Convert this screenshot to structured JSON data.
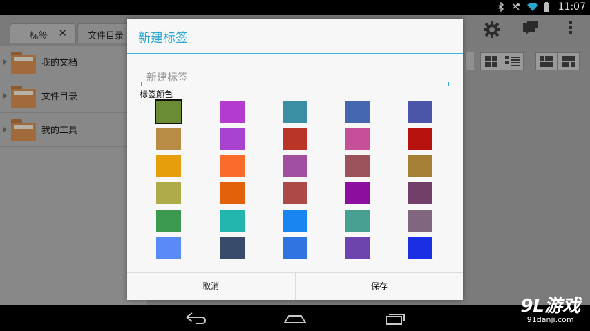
{
  "status_bar": {
    "time": "11:07",
    "icons": [
      "bluetooth-icon",
      "silent-icon",
      "wifi-icon",
      "battery-icon"
    ]
  },
  "tabs": [
    {
      "label": "标签",
      "closable": true
    },
    {
      "label": "文件目录"
    }
  ],
  "sidebar": {
    "items": [
      {
        "label": "我的文档"
      },
      {
        "label": "文件目录"
      },
      {
        "label": "我的工具"
      }
    ]
  },
  "dialog": {
    "title": "新建标签",
    "name_placeholder": "新建标签",
    "color_label": "标签颜色",
    "selected_index": 0,
    "colors": [
      "#6b8c32",
      "#b33ccf",
      "#3a8fa2",
      "#4467b0",
      "#4c56a8",
      "#b98c45",
      "#a943cf",
      "#bb3428",
      "#c64f9a",
      "#b8120f",
      "#e69e0a",
      "#fb6c2a",
      "#a14fa1",
      "#9b525a",
      "#a78037",
      "#aeac48",
      "#e2620b",
      "#ab4a47",
      "#8c0e9e",
      "#713f6a",
      "#3b9950",
      "#23b6ae",
      "#1986f0",
      "#47a091",
      "#80667f",
      "#5a8af7",
      "#394b6b",
      "#2f74e0",
      "#6f43ad",
      "#1a2fe3"
    ],
    "cancel": "取消",
    "save": "保存"
  },
  "watermark": {
    "logo": "9L游戏",
    "site": "91danji.com"
  }
}
